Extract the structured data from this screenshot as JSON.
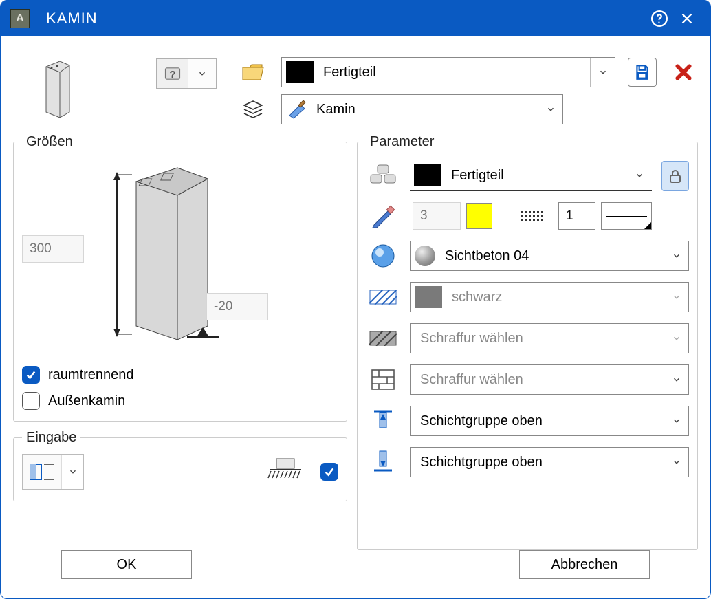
{
  "window": {
    "title": "KAMIN",
    "app_icon_letter": "A"
  },
  "top": {
    "material_combo": "Fertigteil",
    "layer_combo": "Kamin"
  },
  "groups": {
    "sizes_title": "Größen",
    "input_title": "Eingabe",
    "params_title": "Parameter"
  },
  "sizes": {
    "height": "300",
    "offset": "-20",
    "raumtrennend_label": "raumtrennend",
    "aussenkamin_label": "Außenkamin"
  },
  "params": {
    "material": "Fertigteil",
    "pen_value": "3",
    "line_value": "1",
    "surface": "Sichtbeton 04",
    "hatch1": "schwarz",
    "hatch2_placeholder": "Schraffur wählen",
    "hatch3_placeholder": "Schraffur wählen",
    "layergroup_top": "Schichtgruppe oben",
    "layergroup_bottom": "Schichtgruppe oben"
  },
  "buttons": {
    "ok": "OK",
    "cancel": "Abbrechen"
  }
}
